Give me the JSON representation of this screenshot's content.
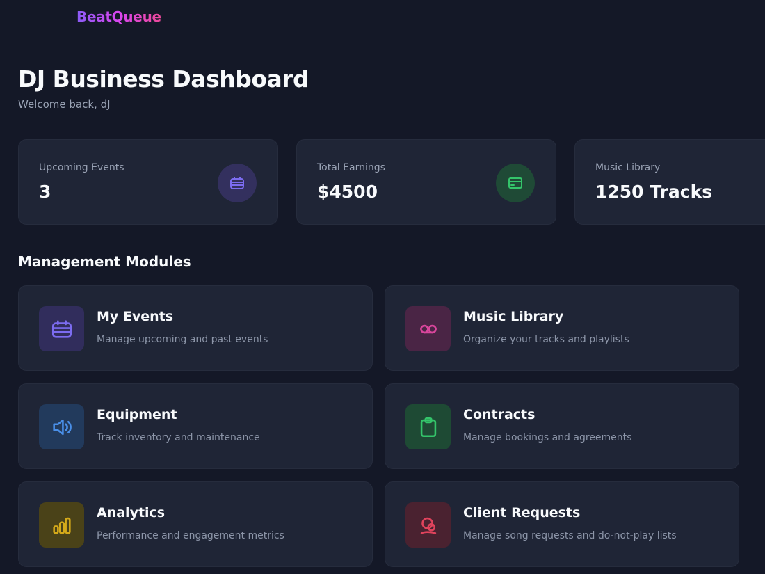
{
  "header": {
    "brand": "BeatQueue"
  },
  "page": {
    "title": "DJ Business Dashboard",
    "subtitle": "Welcome back, dJ"
  },
  "stats": [
    {
      "label": "Upcoming Events",
      "value": "3",
      "icon": "calendar-icon",
      "color": "#7c6cf0"
    },
    {
      "label": "Total Earnings",
      "value": "$4500",
      "icon": "payment-card-icon",
      "color": "#34c46a"
    },
    {
      "label": "Music Library",
      "value": "1250 Tracks"
    }
  ],
  "modules_section": {
    "title": "Management Modules"
  },
  "modules": [
    {
      "title": "My Events",
      "description": "Manage upcoming and past events",
      "icon": "calendar-icon",
      "color": "#7c6cf0"
    },
    {
      "title": "Music Library",
      "description": "Organize your tracks and playlists",
      "icon": "cassette-icon",
      "color": "#d9469c"
    },
    {
      "title": "Equipment",
      "description": "Track inventory and maintenance",
      "icon": "speaker-icon",
      "color": "#4a8fe8"
    },
    {
      "title": "Contracts",
      "description": "Manage bookings and agreements",
      "icon": "clipboard-icon",
      "color": "#34c46a"
    },
    {
      "title": "Analytics",
      "description": "Performance and engagement metrics",
      "icon": "bar-chart-icon",
      "color": "#d4a91a"
    },
    {
      "title": "Client Requests",
      "description": "Manage song requests and do-not-play lists",
      "icon": "request-icon",
      "color": "#e0435c"
    }
  ]
}
